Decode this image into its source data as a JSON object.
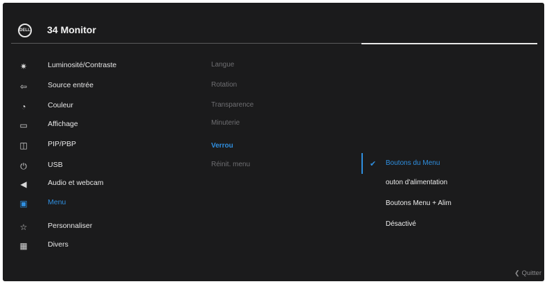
{
  "header": {
    "title": "34 Monitor",
    "logo_text": "DELL"
  },
  "main_menu": {
    "items": [
      {
        "label": "Luminosité/Contraste",
        "icon": "brightness-icon"
      },
      {
        "label": "Source entrée",
        "icon": "input-source-icon"
      },
      {
        "label": "Couleur",
        "icon": "color-palette-icon"
      },
      {
        "label": "Affichage",
        "icon": "display-icon"
      },
      {
        "label": "PIP/PBP",
        "icon": "pip-pbp-icon"
      },
      {
        "label": "USB",
        "icon": "usb-icon"
      },
      {
        "label": "Audio et webcam",
        "icon": "audio-webcam-icon"
      },
      {
        "label": "Menu",
        "icon": "menu-icon",
        "active": true
      },
      {
        "label": "Personnaliser",
        "icon": "star-icon"
      },
      {
        "label": "Divers",
        "icon": "others-icon"
      }
    ]
  },
  "sub_menu": {
    "items": [
      {
        "label": "Langue"
      },
      {
        "label": "Rotation"
      },
      {
        "label": "Transparence"
      },
      {
        "label": "Minuterie"
      },
      {
        "label": "Verrou",
        "active": true
      },
      {
        "label": "Réinit. menu"
      }
    ]
  },
  "options": {
    "items": [
      {
        "label": "Boutons du Menu",
        "selected": true
      },
      {
        "label": "outon d'alimentation"
      },
      {
        "label": "Boutons Menu + Alim"
      },
      {
        "label": "Désactivé"
      }
    ]
  },
  "footer": {
    "quit_label": "Quitter",
    "quit_icon": "chevron-left-icon"
  },
  "colors": {
    "background": "#1b1b1c",
    "accent": "#2f8fe0",
    "text": "#e8e8e8",
    "disabled_text": "#6f6f72"
  }
}
